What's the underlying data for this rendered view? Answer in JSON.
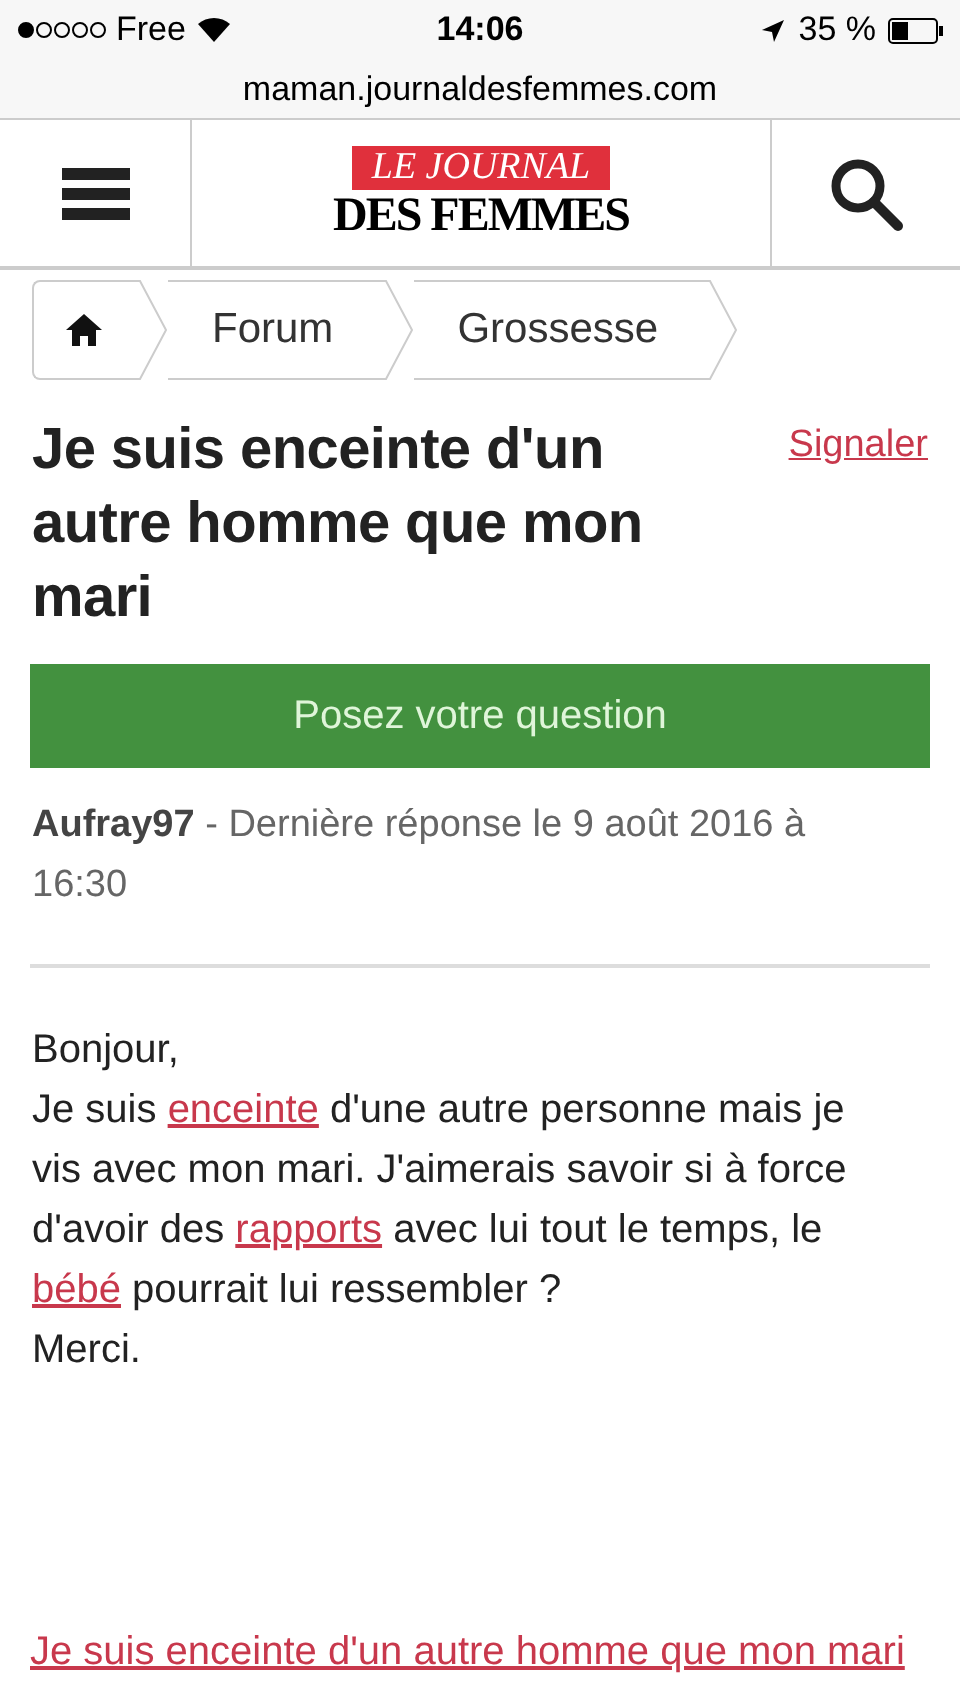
{
  "status_bar": {
    "carrier": "Free",
    "time": "14:06",
    "battery": "35 %"
  },
  "address_bar": {
    "url": "maman.journaldesfemmes.com"
  },
  "header": {
    "logo_top": "LE JOURNAL",
    "logo_bottom": "DES FEMMES"
  },
  "breadcrumb": [
    {
      "kind": "home"
    },
    {
      "kind": "text",
      "label": "Forum"
    },
    {
      "kind": "text",
      "label": "Grossesse"
    }
  ],
  "post": {
    "title": "Je suis enceinte d'un autre homme que mon mari",
    "report_link": "Signaler",
    "ask_button": "Posez votre question",
    "author": "Aufray97",
    "meta": " - Dernière réponse le 9 août 2016 à 16:30",
    "paragraphs": [
      [
        {
          "text": "Bonjour,",
          "link": false
        }
      ],
      [
        {
          "text": "Je suis ",
          "link": false
        },
        {
          "text": "enceinte",
          "link": true
        },
        {
          "text": " d'une autre personne mais je vis avec mon mari. J'aimerais savoir si à force d'avoir des ",
          "link": false
        },
        {
          "text": "rapports",
          "link": true
        },
        {
          "text": " avec lui tout le temps, le ",
          "link": false
        },
        {
          "text": "bébé",
          "link": true
        },
        {
          "text": " pourrait lui ressembler ?",
          "link": false
        }
      ],
      [
        {
          "text": "Merci.",
          "link": false
        }
      ]
    ]
  },
  "related_link": "Je suis enceinte d'un autre homme que mon mari"
}
